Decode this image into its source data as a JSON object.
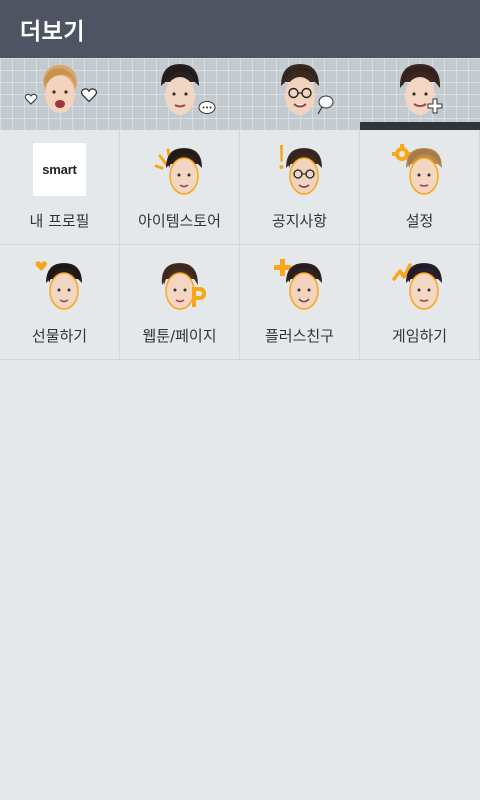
{
  "header": {
    "title": "더보기"
  },
  "tabs": [
    {
      "icon": "heart-icon"
    },
    {
      "icon": "speech-bubble-icon"
    },
    {
      "icon": "heart-comment-icon"
    },
    {
      "icon": "plus-icon",
      "selected": true
    }
  ],
  "menu": [
    {
      "label": "내 프로필",
      "icon": "smart-logo",
      "logo_text": "smart"
    },
    {
      "label": "아이템스토어",
      "icon": "sparkle-icon"
    },
    {
      "label": "공지사항",
      "icon": "exclamation-icon"
    },
    {
      "label": "설정",
      "icon": "gear-icon"
    },
    {
      "label": "선물하기",
      "icon": "heart-icon"
    },
    {
      "label": "웹툰/페이지",
      "icon": "page-p-icon"
    },
    {
      "label": "플러스친구",
      "icon": "plus-icon"
    },
    {
      "label": "게임하기",
      "icon": "game-icon"
    }
  ],
  "colors": {
    "header_bg": "#4f5462",
    "accent_orange": "#f7a718",
    "page_bg": "#e4e8eb"
  }
}
